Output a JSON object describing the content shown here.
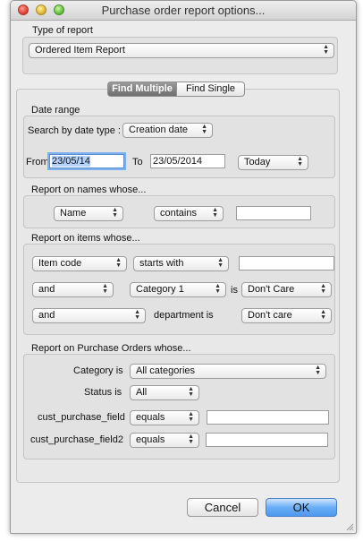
{
  "window": {
    "title": "Purchase order report options..."
  },
  "type_of_report": {
    "label": "Type of report",
    "selected": "Ordered Item Report"
  },
  "tabs": {
    "multiple": "Find Multiple",
    "single": "Find Single"
  },
  "date_range": {
    "label": "Date range",
    "search_by_label": "Search by date type :",
    "date_type": "Creation date",
    "from_label": "From",
    "from_value": "23/05/14",
    "to_label": "To",
    "to_value": "23/05/2014",
    "preset": "Today"
  },
  "names": {
    "label": "Report on names whose...",
    "field": "Name",
    "operator": "contains",
    "value": ""
  },
  "items": {
    "label": "Report on items whose...",
    "row1": {
      "field": "Item code",
      "operator": "starts with",
      "value": ""
    },
    "row2": {
      "conj": "and",
      "field": "Category 1",
      "is_label": "is",
      "value": "Don't Care"
    },
    "row3": {
      "conj": "and",
      "dept_label": "department is",
      "value": "Don't care"
    }
  },
  "purchase_orders": {
    "label": "Report on Purchase Orders whose...",
    "category_label": "Category is",
    "category_value": "All categories",
    "status_label": "Status is",
    "status_value": "All",
    "cf1_label": "cust_purchase_field",
    "cf1_operator": "equals",
    "cf1_value": "",
    "cf2_label": "cust_purchase_field2",
    "cf2_operator": "equals",
    "cf2_value": ""
  },
  "buttons": {
    "cancel": "Cancel",
    "ok": "OK"
  },
  "colors": {
    "default_button": "#4e98ee",
    "selection": "#b5d3ff"
  }
}
